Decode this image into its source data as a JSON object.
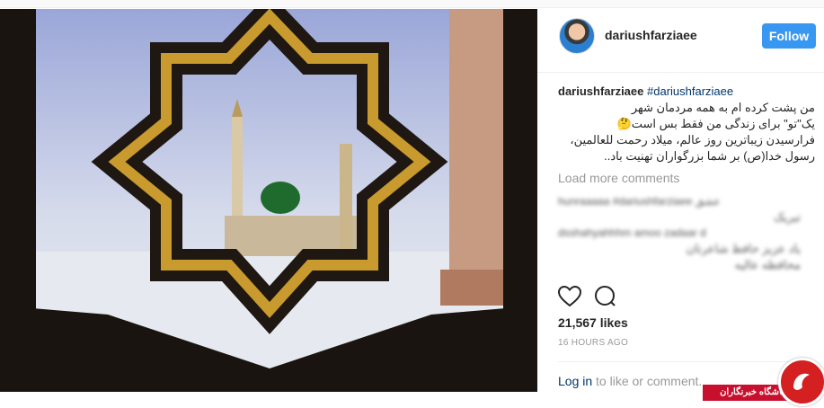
{
  "post": {
    "username": "dariushfarziaee",
    "follow_label": "Follow",
    "caption_user": "dariushfarziaee",
    "caption_tag": "#dariushfarziaee",
    "caption_lines": [
      "من پشت کرده ام به همه مردمان شهر",
      "یک\"تو\" برای زندگی من فقط بس است🤔",
      "فرارسیدن زیباترین روز عالم، میلاد رحمت للعالمین،",
      "رسول خدا(ص) بر شما بزرگواران تهنیت باد.."
    ],
    "load_more": "Load more comments",
    "blurred_comments": [
      "hunraaaaa #dariushfarziaee عشق",
      "تبریک",
      "dsshahyahhhm amoo zadaar d",
      "یاد عزیز حافظ شاعرتان",
      "محافظه عالیه"
    ],
    "likes": "21,567 likes",
    "time_ago": "16 HOURS AGO",
    "login_link": "Log in",
    "login_rest": " to like or comment."
  },
  "icons": {
    "like": "heart-icon",
    "comment": "comment-icon"
  },
  "watermark": {
    "text": "باشگاه خبرنگاران"
  },
  "colors": {
    "follow": "#3897f0",
    "hashtag": "#003569",
    "watermark": "#c8102e"
  }
}
